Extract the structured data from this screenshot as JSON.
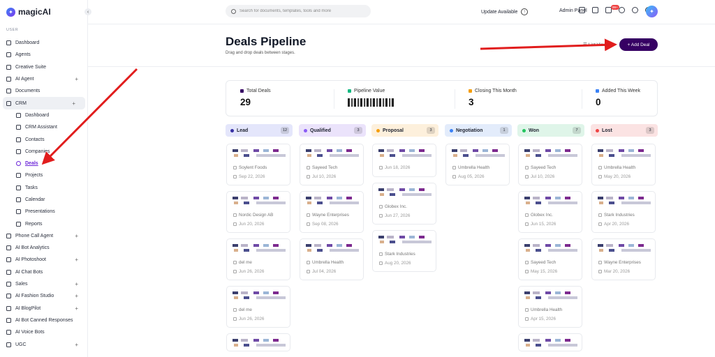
{
  "app": {
    "logo_text": "magicAI",
    "collapse_glyph": "‹"
  },
  "sidebar": {
    "section_label": "USER",
    "items": [
      {
        "label": "Dashboard",
        "icon": "grid-icon",
        "plus": false
      },
      {
        "label": "Agents",
        "icon": "rocket-icon",
        "plus": false
      },
      {
        "label": "Creative Suite",
        "icon": "palette-icon",
        "plus": false
      },
      {
        "label": "AI Agent",
        "icon": "bot-icon",
        "plus": true
      },
      {
        "label": "Documents",
        "icon": "document-icon",
        "plus": false
      },
      {
        "label": "CRM",
        "icon": "briefcase-icon",
        "plus": true
      }
    ],
    "crm_sub": [
      {
        "label": "Dashboard",
        "icon": "grid-icon"
      },
      {
        "label": "CRM Assistant",
        "icon": "chat-icon"
      },
      {
        "label": "Contacts",
        "icon": "contact-icon"
      },
      {
        "label": "Companies",
        "icon": "building-icon"
      },
      {
        "label": "Deals",
        "icon": "dollar-icon"
      },
      {
        "label": "Projects",
        "icon": "folder-icon"
      },
      {
        "label": "Tasks",
        "icon": "clipboard-icon"
      },
      {
        "label": "Calendar",
        "icon": "calendar-icon"
      },
      {
        "label": "Presentations",
        "icon": "presentation-icon"
      },
      {
        "label": "Reports",
        "icon": "chart-icon"
      }
    ],
    "after": [
      {
        "label": "Phone Call Agent",
        "icon": "phone-icon",
        "plus": true
      },
      {
        "label": "AI Bot Analytics",
        "icon": "analytics-icon",
        "plus": false
      },
      {
        "label": "AI Photoshoot",
        "icon": "camera-icon",
        "plus": true
      },
      {
        "label": "AI Chat Bots",
        "icon": "bot-icon",
        "plus": false
      },
      {
        "label": "Sales",
        "icon": "sales-icon",
        "plus": true
      },
      {
        "label": "AI Fashion Studio",
        "icon": "shirt-icon",
        "plus": true
      },
      {
        "label": "AI BlogPilot",
        "icon": "blog-icon",
        "plus": true
      },
      {
        "label": "AI Bot Canned Responses",
        "icon": "reply-icon",
        "plus": false
      },
      {
        "label": "AI Voice Bots",
        "icon": "voice-icon",
        "plus": false
      },
      {
        "label": "UGC",
        "icon": "video-icon",
        "plus": true
      }
    ]
  },
  "topbar": {
    "search_placeholder": "Search for documents, templates, tools and more",
    "update_label": "Update Available",
    "admin_label": "Admin Panel",
    "notification_badge": "99+"
  },
  "header": {
    "title": "Deals Pipeline",
    "subtitle": "Drag and drop deals between stages.",
    "list_view_label": "List View",
    "add_deal_label": "+ Add Deal"
  },
  "stats": [
    {
      "label": "Total Deals",
      "value": "29",
      "color": "#360063"
    },
    {
      "label": "Pipeline Value",
      "value": "",
      "color": "#10b981"
    },
    {
      "label": "Closing This Month",
      "value": "3",
      "color": "#f59e0b"
    },
    {
      "label": "Added This Week",
      "value": "0",
      "color": "#3b82f6"
    }
  ],
  "columns": [
    {
      "name": "Lead",
      "count": "12",
      "bg": "#e4e6fb",
      "dot": "#3730a3",
      "cards": [
        {
          "company": "Soylent Foods",
          "date": "Sep 22, 2026"
        },
        {
          "company": "Nordic Design AB",
          "date": "Jun 20, 2026"
        },
        {
          "company": "del me",
          "date": "Jun 26, 2026"
        },
        {
          "company": "del me",
          "date": "Jun 26, 2026"
        },
        {
          "company": "",
          "date": ""
        }
      ]
    },
    {
      "name": "Qualified",
      "count": "3",
      "bg": "#ebe3fb",
      "dot": "#8b5cf6",
      "cards": [
        {
          "company": "Sayeed Tech",
          "date": "Jul 10, 2026"
        },
        {
          "company": "Wayne Enterprises",
          "date": "Sep 08, 2026"
        },
        {
          "company": "Umbrella Health",
          "date": "Jul 04, 2026"
        }
      ]
    },
    {
      "name": "Proposal",
      "count": "3",
      "bg": "#fdf0dc",
      "dot": "#f59e0b",
      "cards": [
        {
          "company": "",
          "date": "Jun 18, 2026"
        },
        {
          "company": "Globex Inc.",
          "date": "Jun 27, 2026"
        },
        {
          "company": "Stark Industries",
          "date": "Aug 20, 2026"
        }
      ]
    },
    {
      "name": "Negotiation",
      "count": "1",
      "bg": "#e3ecfb",
      "dot": "#3b82f6",
      "cards": [
        {
          "company": "Umbrella Health",
          "date": "Aug 05, 2026"
        }
      ]
    },
    {
      "name": "Won",
      "count": "7",
      "bg": "#dff5e9",
      "dot": "#22c55e",
      "cards": [
        {
          "company": "Sayeed Tech",
          "date": "Jul 10, 2026"
        },
        {
          "company": "Globex Inc.",
          "date": "Jun 15, 2026"
        },
        {
          "company": "Sayeed Tech",
          "date": "May 15, 2026"
        },
        {
          "company": "Umbrella Health",
          "date": "Apr 15, 2026"
        },
        {
          "company": "",
          "date": ""
        }
      ]
    },
    {
      "name": "Lost",
      "count": "3",
      "bg": "#fbe3e3",
      "dot": "#ef4444",
      "cards": [
        {
          "company": "Umbrella Health",
          "date": "May 20, 2026"
        },
        {
          "company": "Stark Industries",
          "date": "Apr 20, 2026"
        },
        {
          "company": "Wayne Enterprises",
          "date": "Mar 20, 2026"
        }
      ]
    }
  ]
}
